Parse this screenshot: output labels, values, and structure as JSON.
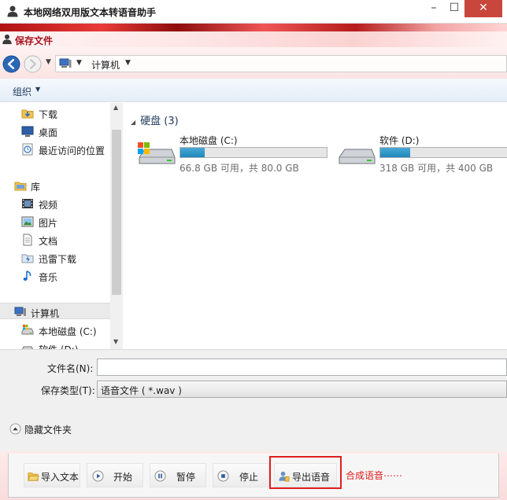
{
  "window": {
    "title": "本地网络双用版文本转语音助手",
    "minimize_glyph": "–",
    "maximize_glyph": "☐",
    "close_glyph": "✕"
  },
  "dialog": {
    "title": "保存文件"
  },
  "navigation": {
    "breadcrumb": "计算机"
  },
  "command_bar": {
    "organize_label": "组织"
  },
  "sidebar": {
    "favorites": [
      {
        "label": "下载",
        "icon": "download-folder-icon"
      },
      {
        "label": "桌面",
        "icon": "desktop-icon"
      },
      {
        "label": "最近访问的位置",
        "icon": "recent-places-icon"
      }
    ],
    "libraries_label": "库",
    "libraries": [
      {
        "label": "视频",
        "icon": "video-library-icon"
      },
      {
        "label": "图片",
        "icon": "picture-library-icon"
      },
      {
        "label": "文档",
        "icon": "document-library-icon"
      },
      {
        "label": "迅雷下载",
        "icon": "thunder-download-icon"
      },
      {
        "label": "音乐",
        "icon": "music-library-icon"
      }
    ],
    "computer_label": "计算机",
    "drives": [
      {
        "label": "本地磁盘 (C:)",
        "icon": "local-disk-icon"
      },
      {
        "label": "软件 (D:)",
        "icon": "local-disk-icon"
      }
    ]
  },
  "content": {
    "group_title": "硬盘 (3)",
    "drives": [
      {
        "name": "本地磁盘 (C:)",
        "free_text": "66.8 GB 可用，共 80.0 GB",
        "used_fraction": 0.165
      },
      {
        "name": "软件 (D:)",
        "free_text": "318 GB 可用，共 400 GB",
        "used_fraction": 0.205
      }
    ]
  },
  "file_panel": {
    "filename_label": "文件名(N):",
    "filename_value": "",
    "filetype_label": "保存类型(T):",
    "filetype_value": "语音文件 ( *.wav )",
    "hide_folders_label": "隐藏文件夹"
  },
  "toolbar": {
    "import_label": "导入文本",
    "start_label": "开始",
    "pause_label": "暂停",
    "stop_label": "停止",
    "export_label": "导出语音",
    "annotation": "合成语音⋯⋯"
  },
  "colors": {
    "accent_red": "#e01e1e",
    "dialog_title_red": "#a8131f",
    "drive_bar": "#1f87bd",
    "close_button": "#c9463d"
  }
}
